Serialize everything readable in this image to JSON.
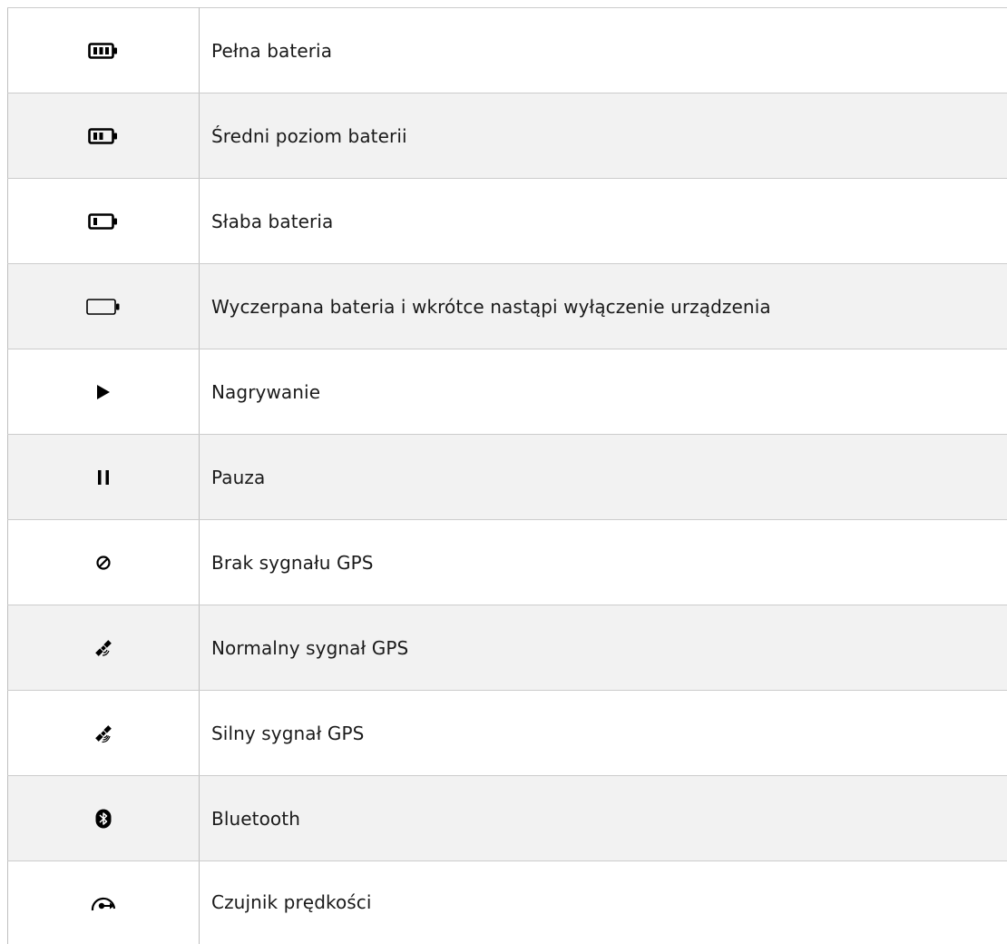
{
  "icon_legend": {
    "rows": [
      {
        "icon": "battery-full-icon",
        "label": "Pełna bateria"
      },
      {
        "icon": "battery-medium-icon",
        "label": "Średni poziom baterii"
      },
      {
        "icon": "battery-low-icon",
        "label": "Słaba bateria"
      },
      {
        "icon": "battery-empty-icon",
        "label": "Wyczerpana bateria i wkrótce nastąpi wyłączenie urządzenia"
      },
      {
        "icon": "play-icon",
        "label": "Nagrywanie"
      },
      {
        "icon": "pause-icon",
        "label": "Pauza"
      },
      {
        "icon": "no-gps-signal-icon",
        "label": "Brak sygnału GPS"
      },
      {
        "icon": "gps-normal-signal-icon",
        "label": "Normalny sygnał GPS"
      },
      {
        "icon": "gps-strong-signal-icon",
        "label": "Silny sygnał GPS"
      },
      {
        "icon": "bluetooth-icon",
        "label": "Bluetooth"
      },
      {
        "icon": "speed-sensor-icon",
        "label": "Czujnik prędkości"
      }
    ]
  },
  "colors": {
    "row_shade": "#f2f2f2",
    "border": "#cccccc",
    "text": "#1a1a1a",
    "icon": "#000000"
  }
}
